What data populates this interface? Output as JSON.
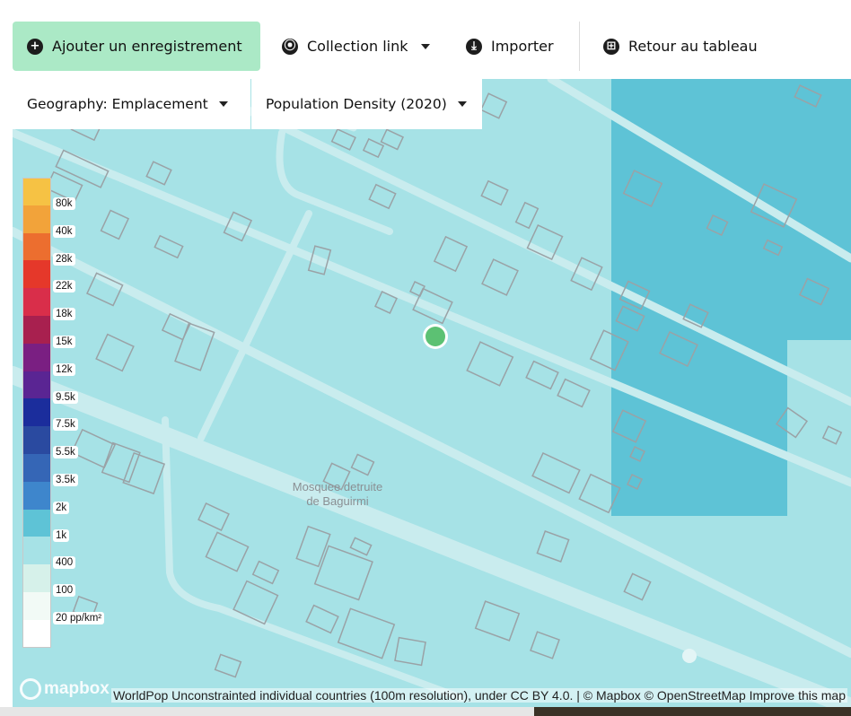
{
  "toolbar": {
    "add_record": {
      "label": "Ajouter un enregistrement",
      "icon": "plus-circle-icon",
      "glyph": "+"
    },
    "collection_link": {
      "label": "Collection link",
      "icon": "link-icon",
      "glyph": "⦿"
    },
    "import": {
      "label": "Importer",
      "icon": "import-icon",
      "glyph": "⤓"
    },
    "back": {
      "label": "Retour au tableau",
      "icon": "table-icon",
      "glyph": "⊞"
    }
  },
  "map": {
    "geography_select": {
      "label": "Geography: Emplacement"
    },
    "variable_select": {
      "label": "Population Density (2020)"
    },
    "place_label_line1": "Mosquee detruite",
    "place_label_line2": "de Baguirmi",
    "attribution": "WorldPop Unconstrainted individual countries (100m resolution), under CC BY 4.0. | © Mapbox © OpenStreetMap Improve this map",
    "logo": "mapbox",
    "marker_color": "#5cc173",
    "base_color": "#a6e2e6",
    "high_cell_color": "#5ec3d6"
  },
  "legend": [
    {
      "label": "80k",
      "color": "#f6c244"
    },
    {
      "label": "40k",
      "color": "#f2a33a"
    },
    {
      "label": "28k",
      "color": "#ec6e2f"
    },
    {
      "label": "22k",
      "color": "#e5382a"
    },
    {
      "label": "18k",
      "color": "#d92e4a"
    },
    {
      "label": "15k",
      "color": "#a8204f"
    },
    {
      "label": "12k",
      "color": "#7a1f82"
    },
    {
      "label": "9.5k",
      "color": "#5a2593"
    },
    {
      "label": "7.5k",
      "color": "#1b2d9c"
    },
    {
      "label": "5.5k",
      "color": "#2a4aa0"
    },
    {
      "label": "3.5k",
      "color": "#3566b6"
    },
    {
      "label": "2k",
      "color": "#3e86cc"
    },
    {
      "label": "1k",
      "color": "#5ec3d6"
    },
    {
      "label": "400",
      "color": "#a6e2e6"
    },
    {
      "label": "100",
      "color": "#d6f1ea"
    },
    {
      "label": "20 pp/km²",
      "color": "#f2faf6"
    },
    {
      "label": "",
      "color": "#ffffff"
    }
  ]
}
